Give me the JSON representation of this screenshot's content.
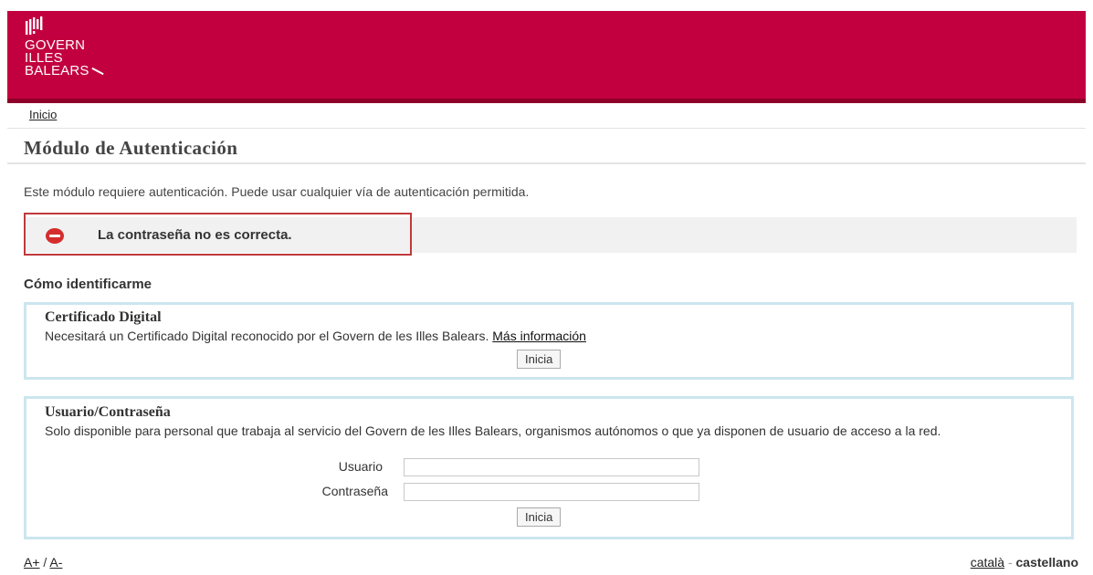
{
  "header": {
    "logo_lines": [
      "GOVERN",
      "ILLES",
      "BALEARS"
    ],
    "brand_color": "#c2003f"
  },
  "breadcrumb": {
    "home": "Inicio"
  },
  "page": {
    "title": "Módulo de Autenticación",
    "intro": "Este módulo requiere autenticación. Puede usar cualquier vía de autenticación permitida."
  },
  "error": {
    "icon": "error-icon",
    "message": "La contraseña no es correcta.",
    "color": "#d42d2d"
  },
  "section": {
    "title": "Cómo identificarme"
  },
  "certificate": {
    "title": "Certificado Digital",
    "description": "Necesitará un Certificado Digital reconocido por el Govern de les Illes Balears.",
    "link": "Más información",
    "button": "Inicia"
  },
  "credentials": {
    "title": "Usuario/Contraseña",
    "description": "Solo disponible para personal que trabaja al servicio del Govern de les Illes Balears, organismos autónomos o que ya disponen de usuario de acceso a la red.",
    "user_label": "Usuario",
    "user_value": "",
    "password_label": "Contraseña",
    "password_value": "",
    "button": "Inicia"
  },
  "footer": {
    "font_increase": "A+",
    "separator": "/",
    "font_decrease": "A-",
    "lang_ca": "català",
    "lang_separator": "-",
    "lang_es": "castellano"
  }
}
